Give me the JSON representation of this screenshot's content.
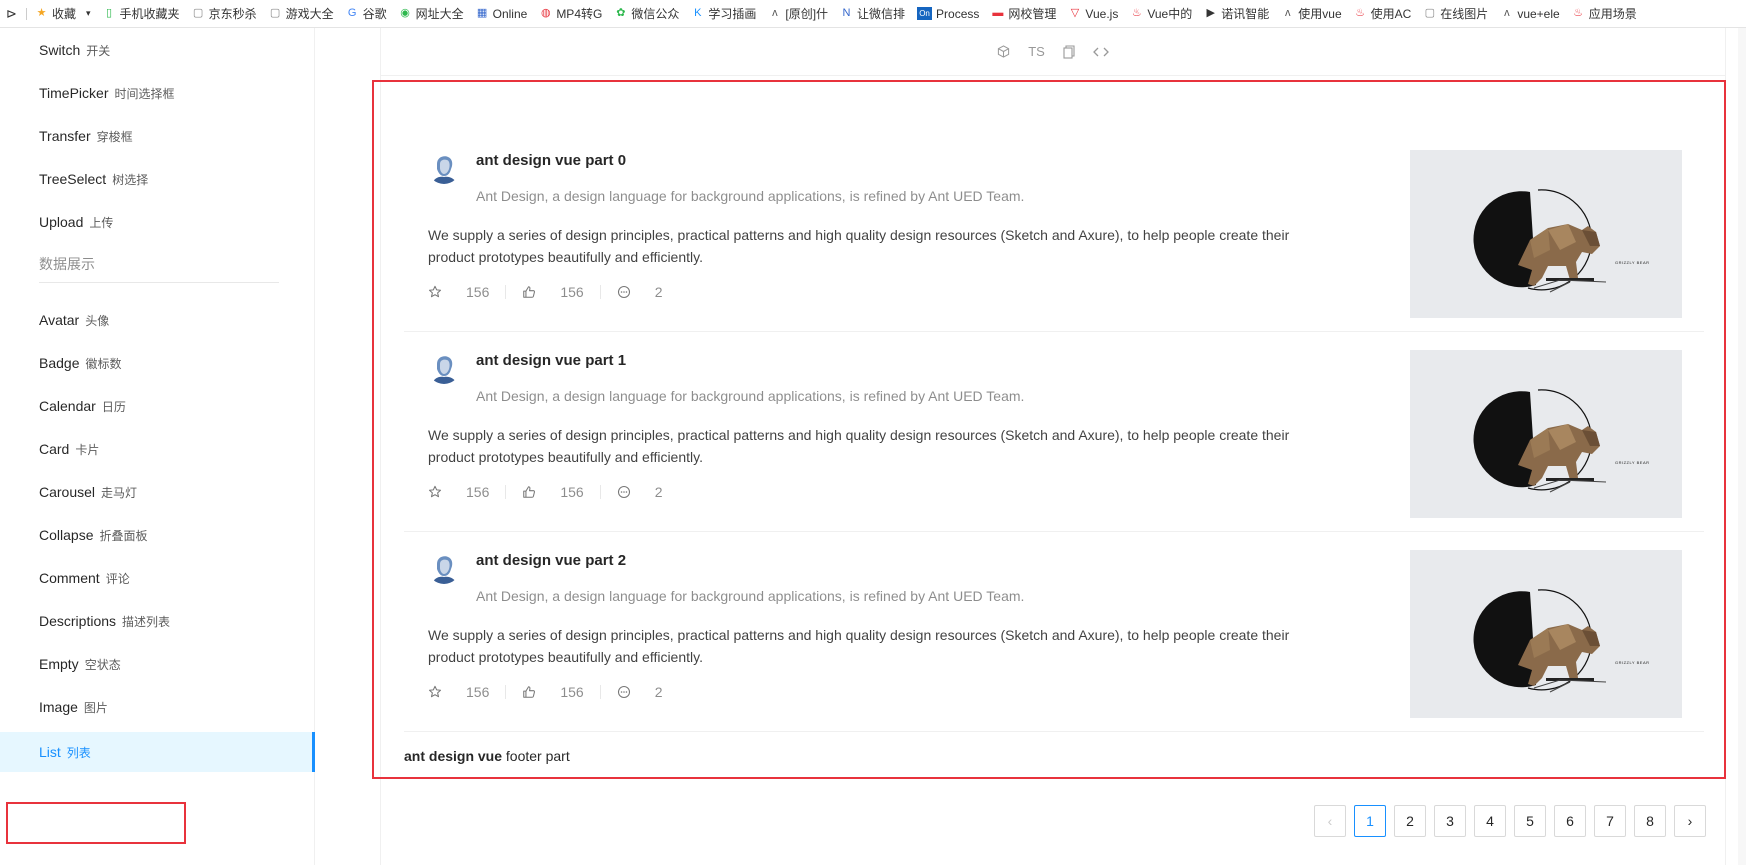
{
  "bookmarks": [
    {
      "label": "收藏",
      "icon": "star-icon",
      "color": "#f5a623"
    },
    {
      "label": "手机收藏夹",
      "icon": "phone-icon",
      "color": "#2db84d"
    },
    {
      "label": "京东秒杀",
      "icon": "page-icon",
      "color": "#888888"
    },
    {
      "label": "游戏大全",
      "icon": "page-icon",
      "color": "#888888"
    },
    {
      "label": "谷歌",
      "icon": "google-icon",
      "color": "#4285f4"
    },
    {
      "label": "网址大全",
      "icon": "globe-icon",
      "color": "#2db84d"
    },
    {
      "label": "Online",
      "icon": "grid-icon",
      "color": "#3366cc"
    },
    {
      "label": "MP4转G",
      "icon": "circle-icon",
      "color": "#e8323c"
    },
    {
      "label": "微信公众",
      "icon": "wechat-icon",
      "color": "#2db84d"
    },
    {
      "label": "学习插画",
      "icon": "k-icon",
      "color": "#1890ff"
    },
    {
      "label": "[原创]什",
      "icon": "leaf-icon",
      "color": "#555555"
    },
    {
      "label": "让微信排",
      "icon": "n-icon",
      "color": "#3366cc"
    },
    {
      "label": "Process",
      "icon": "on-icon",
      "color": "#1565c0"
    },
    {
      "label": "网校管理",
      "icon": "book-icon",
      "color": "#e8323c"
    },
    {
      "label": "Vue.js",
      "icon": "vue-icon",
      "color": "#e8323c"
    },
    {
      "label": "Vue中的",
      "icon": "flame-icon",
      "color": "#e8323c"
    },
    {
      "label": "诺讯智能",
      "icon": "play-icon",
      "color": "#333333"
    },
    {
      "label": "使用vue",
      "icon": "leaf-icon",
      "color": "#555555"
    },
    {
      "label": "使用AC",
      "icon": "flame-icon",
      "color": "#e8323c"
    },
    {
      "label": "在线图片",
      "icon": "page-icon",
      "color": "#888888"
    },
    {
      "label": "vue+ele",
      "icon": "leaf-icon",
      "color": "#555555"
    },
    {
      "label": "应用场景",
      "icon": "flame-icon",
      "color": "#e8323c"
    }
  ],
  "sidebar": {
    "items_top": [
      {
        "en": "Switch",
        "cn": "开关"
      },
      {
        "en": "TimePicker",
        "cn": "时间选择框"
      },
      {
        "en": "Transfer",
        "cn": "穿梭框"
      },
      {
        "en": "TreeSelect",
        "cn": "树选择"
      },
      {
        "en": "Upload",
        "cn": "上传"
      }
    ],
    "group_label": "数据展示",
    "items_bottom": [
      {
        "en": "Avatar",
        "cn": "头像"
      },
      {
        "en": "Badge",
        "cn": "徽标数"
      },
      {
        "en": "Calendar",
        "cn": "日历"
      },
      {
        "en": "Card",
        "cn": "卡片"
      },
      {
        "en": "Carousel",
        "cn": "走马灯"
      },
      {
        "en": "Collapse",
        "cn": "折叠面板"
      },
      {
        "en": "Comment",
        "cn": "评论"
      },
      {
        "en": "Descriptions",
        "cn": "描述列表"
      },
      {
        "en": "Empty",
        "cn": "空状态"
      },
      {
        "en": "Image",
        "cn": "图片"
      },
      {
        "en": "List",
        "cn": "列表"
      }
    ],
    "accent": "#1890ff"
  },
  "demo_toolbar": {
    "ts_label": "TS"
  },
  "list": {
    "items": [
      {
        "title": "ant design vue part 0",
        "description": "Ant Design, a design language for background applications, is refined by Ant UED Team.",
        "content": "We supply a series of design principles, practical patterns and high quality design resources (Sketch and Axure), to help people create their product prototypes beautifully and efficiently.",
        "stars": "156",
        "likes": "156",
        "messages": "2"
      },
      {
        "title": "ant design vue part 1",
        "description": "Ant Design, a design language for background applications, is refined by Ant UED Team.",
        "content": "We supply a series of design principles, practical patterns and high quality design resources (Sketch and Axure), to help people create their product prototypes beautifully and efficiently.",
        "stars": "156",
        "likes": "156",
        "messages": "2"
      },
      {
        "title": "ant design vue part 2",
        "description": "Ant Design, a design language for background applications, is refined by Ant UED Team.",
        "content": "We supply a series of design principles, practical patterns and high quality design resources (Sketch and Axure), to help people create their product prototypes beautifully and efficiently.",
        "stars": "156",
        "likes": "156",
        "messages": "2"
      }
    ],
    "thumb_caption": "GRIZZLY BEAR",
    "footer_bold": "ant design vue",
    "footer_text": " footer part"
  },
  "pagination": {
    "pages": [
      "1",
      "2",
      "3",
      "4",
      "5",
      "6",
      "7",
      "8"
    ],
    "current": "1"
  },
  "highlight_color": "#e8323c"
}
